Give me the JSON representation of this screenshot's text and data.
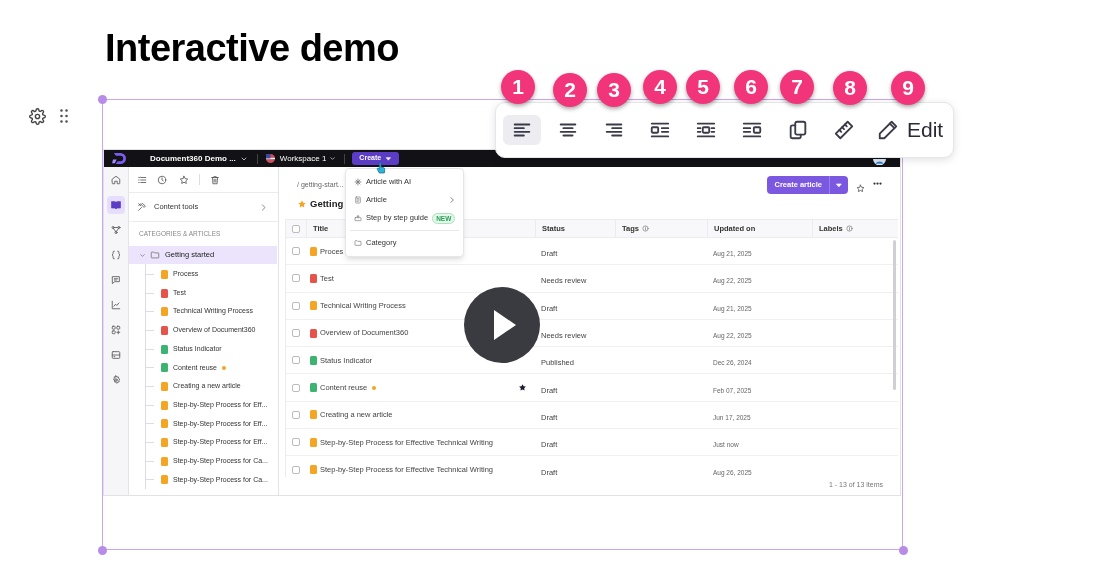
{
  "page_title": "Interactive demo",
  "toolbar": {
    "buttons": [
      {
        "kind": "align-left",
        "selected": true
      },
      {
        "kind": "align-center",
        "selected": false
      },
      {
        "kind": "align-right",
        "selected": false
      },
      {
        "kind": "wrap-left",
        "selected": false
      },
      {
        "kind": "wrap-inline",
        "selected": false
      },
      {
        "kind": "wrap-right",
        "selected": false
      },
      {
        "kind": "copy",
        "selected": false
      },
      {
        "kind": "ruler",
        "selected": false
      },
      {
        "kind": "edit",
        "label": "Edit",
        "selected": false
      }
    ]
  },
  "step_badges": [
    "1",
    "2",
    "3",
    "4",
    "5",
    "6",
    "7",
    "8",
    "9"
  ],
  "app": {
    "topbar": {
      "project": "Document360 Demo ...",
      "workspace": "Workspace 1",
      "create_button": "Create"
    },
    "rail": [
      {
        "kind": "home",
        "selected": false
      },
      {
        "kind": "book",
        "selected": true
      },
      {
        "kind": "diagram",
        "selected": false
      },
      {
        "kind": "code",
        "selected": false
      },
      {
        "kind": "chat",
        "selected": false
      },
      {
        "kind": "chart",
        "selected": false
      },
      {
        "kind": "apps",
        "selected": false
      },
      {
        "kind": "drive",
        "selected": false
      },
      {
        "kind": "settings",
        "selected": false
      }
    ],
    "sidebar": {
      "content_tools": "Content tools",
      "section_label": "CATEGORIES & ARTICLES",
      "category": {
        "label": "Getting started",
        "expanded": true,
        "selected": true,
        "children": [
          {
            "label": "Process",
            "color": "#f5a524",
            "dot": false
          },
          {
            "label": "Test",
            "color": "#e5534b",
            "dot": false
          },
          {
            "label": "Technical Writing Process",
            "color": "#f5a524",
            "dot": false
          },
          {
            "label": "Overview of Document360",
            "color": "#e5534b",
            "dot": false
          },
          {
            "label": "Status Indicator",
            "color": "#3cb371",
            "dot": false
          },
          {
            "label": "Content reuse",
            "color": "#3cb371",
            "dot": true
          },
          {
            "label": "Creating a new article",
            "color": "#f5a524",
            "dot": false
          },
          {
            "label": "Step-by-Step Process for Eff...",
            "color": "#f5a524",
            "dot": false
          },
          {
            "label": "Step-by-Step Process for Eff...",
            "color": "#f5a524",
            "dot": false
          },
          {
            "label": "Step-by-Step Process for Eff...",
            "color": "#f5a524",
            "dot": false
          },
          {
            "label": "Step-by-Step Process for Ca...",
            "color": "#f5a524",
            "dot": false
          },
          {
            "label": "Step-by-Step Process for Ca...",
            "color": "#f5a524",
            "dot": false
          }
        ]
      }
    },
    "breadcrumb": "/ getting-start...",
    "heading": "Getting",
    "create_article": "Create article",
    "table": {
      "select_all_checked": false,
      "columns": [
        {
          "label": "Title",
          "info": false
        },
        {
          "label": "Status",
          "info": false
        },
        {
          "label": "Tags",
          "info": true
        },
        {
          "label": "Updated on",
          "info": false
        },
        {
          "label": "Labels",
          "info": true
        }
      ],
      "rows": [
        {
          "title": "Proces",
          "checked": false,
          "color": "#f5a524",
          "dot": false,
          "starred": false,
          "status": "Draft",
          "updated": "Aug 21, 2025"
        },
        {
          "title": "Test",
          "checked": false,
          "color": "#e5534b",
          "dot": false,
          "starred": false,
          "status": "Needs review",
          "updated": "Aug 22, 2025"
        },
        {
          "title": "Technical Writing Process",
          "checked": false,
          "color": "#f5a524",
          "dot": false,
          "starred": false,
          "status": "Draft",
          "updated": "Aug 21, 2025"
        },
        {
          "title": "Overview of Document360",
          "checked": false,
          "color": "#e5534b",
          "dot": false,
          "starred": false,
          "status": "Needs review",
          "updated": "Aug 22, 2025"
        },
        {
          "title": "Status Indicator",
          "checked": false,
          "color": "#3cb371",
          "dot": false,
          "starred": false,
          "status": "Published",
          "updated": "Dec 26, 2024"
        },
        {
          "title": "Content reuse",
          "checked": false,
          "color": "#3cb371",
          "dot": true,
          "starred": true,
          "status": "Draft",
          "updated": "Feb 07, 2025"
        },
        {
          "title": "Creating a new article",
          "checked": false,
          "color": "#f5a524",
          "dot": false,
          "starred": false,
          "status": "Draft",
          "updated": "Jun 17, 2025"
        },
        {
          "title": "Step-by-Step Process for Effective Technical Writing",
          "checked": false,
          "color": "#f5a524",
          "dot": false,
          "starred": false,
          "status": "Draft",
          "updated": "Just now"
        },
        {
          "title": "Step-by-Step Process for Effective Technical Writing",
          "checked": false,
          "color": "#f5a524",
          "dot": false,
          "starred": false,
          "status": "Draft",
          "updated": "Aug 26, 2025"
        }
      ],
      "footer": "1 - 13 of 13 items"
    },
    "create_menu": [
      {
        "kind": "ai",
        "label": "Article with AI"
      },
      {
        "kind": "article",
        "label": "Article",
        "submenu": true
      },
      {
        "kind": "guide",
        "label": "Step by step guide",
        "badge": "NEW"
      },
      {
        "kind": "category",
        "label": "Category"
      }
    ]
  }
}
